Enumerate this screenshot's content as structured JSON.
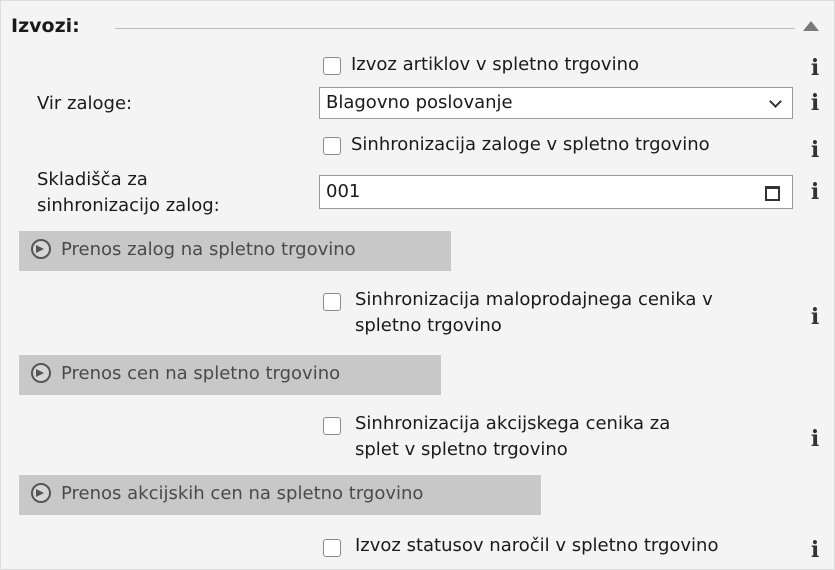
{
  "section": {
    "title": "Izvozi:"
  },
  "export_items": {
    "label": "Izvoz artiklov v spletno trgovino",
    "info": "i"
  },
  "stock_source": {
    "label": "Vir zaloge:",
    "value": "Blagovno poslovanje",
    "info": "i"
  },
  "sync_stock": {
    "label": "Sinhronizacija zaloge v spletno trgovino",
    "info": "i"
  },
  "warehouses": {
    "label_line1": "Skladišča za",
    "label_line2": "sinhronizacijo zalog:",
    "value": "001",
    "info": "i"
  },
  "transfer_stock_button": {
    "label": "Prenos zalog na spletno trgovino"
  },
  "sync_retail": {
    "label_line1": "Sinhronizacija maloprodajnega cenika v",
    "label_line2": "spletno trgovino",
    "info": "i"
  },
  "transfer_prices_button": {
    "label": "Prenos cen na spletno trgovino"
  },
  "sync_promo": {
    "label_line1": "Sinhronizacija akcijskega cenika za",
    "label_line2": "splet v spletno trgovino",
    "info": "i"
  },
  "transfer_promo_button": {
    "label": "Prenos akcijskih cen na spletno trgovino"
  },
  "export_order_status": {
    "label": "Izvoz statusov naročil v spletno trgovino",
    "info": "i"
  }
}
